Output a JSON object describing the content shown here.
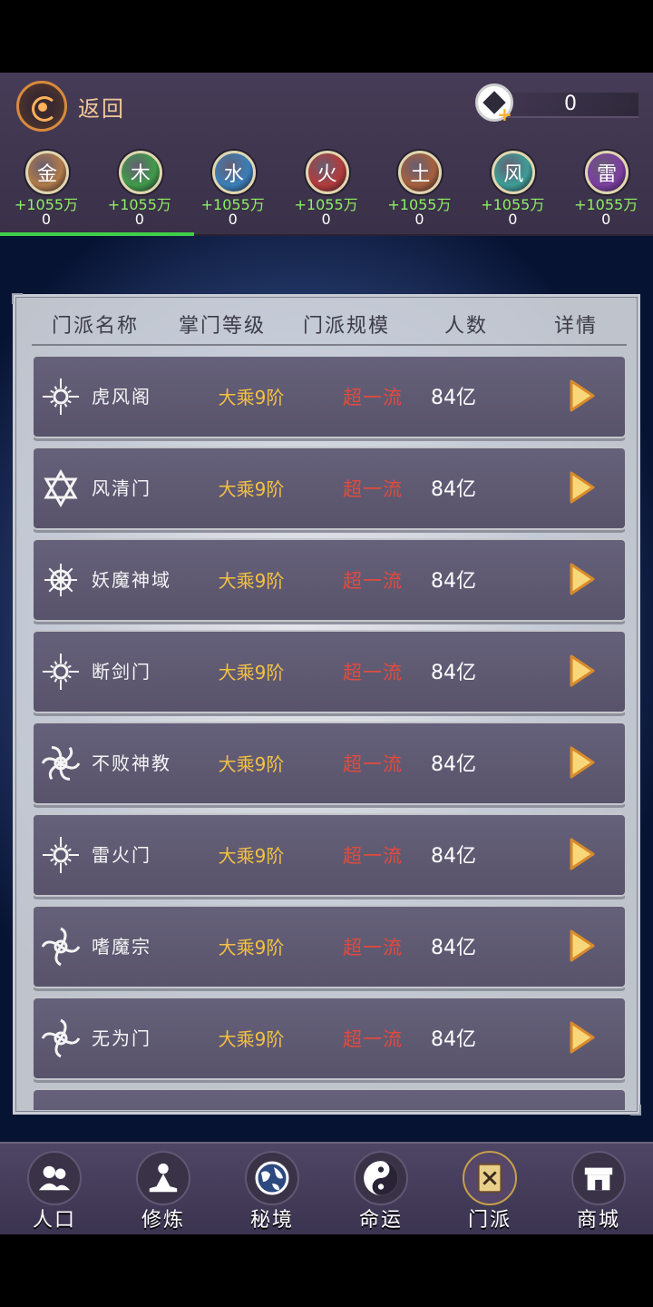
{
  "header": {
    "back_label": "返回",
    "currency_value": "0"
  },
  "elements": [
    {
      "char": "金",
      "gain": "+1055万",
      "count": "0",
      "color": "#b07a4a"
    },
    {
      "char": "木",
      "gain": "+1055万",
      "count": "0",
      "color": "#3f9a4a"
    },
    {
      "char": "水",
      "gain": "+1055万",
      "count": "0",
      "color": "#3a7fb8"
    },
    {
      "char": "火",
      "gain": "+1055万",
      "count": "0",
      "color": "#b23b3b"
    },
    {
      "char": "土",
      "gain": "+1055万",
      "count": "0",
      "color": "#a5603e"
    },
    {
      "char": "风",
      "gain": "+1055万",
      "count": "0",
      "color": "#3e9d96"
    },
    {
      "char": "雷",
      "gain": "+1055万",
      "count": "0",
      "color": "#7c3ea0"
    }
  ],
  "table": {
    "headers": {
      "name": "门派名称",
      "leader_level": "掌门等级",
      "scale": "门派规模",
      "population": "人数",
      "details": "详情"
    },
    "rows": [
      {
        "name": "虎风阁",
        "rank": "大乘9阶",
        "scale": "超一流",
        "population": "84亿",
        "emblem": "sun-emblem-icon"
      },
      {
        "name": "风清门",
        "rank": "大乘9阶",
        "scale": "超一流",
        "population": "84亿",
        "emblem": "hexagram-emblem-icon"
      },
      {
        "name": "妖魔神域",
        "rank": "大乘9阶",
        "scale": "超一流",
        "population": "84亿",
        "emblem": "triskele-emblem-icon"
      },
      {
        "name": "断剑门",
        "rank": "大乘9阶",
        "scale": "超一流",
        "population": "84亿",
        "emblem": "star-emblem-icon"
      },
      {
        "name": "不败神教",
        "rank": "大乘9阶",
        "scale": "超一流",
        "population": "84亿",
        "emblem": "spiral-emblem-icon"
      },
      {
        "name": "雷火门",
        "rank": "大乘9阶",
        "scale": "超一流",
        "population": "84亿",
        "emblem": "sun-emblem-icon"
      },
      {
        "name": "嗜魔宗",
        "rank": "大乘9阶",
        "scale": "超一流",
        "population": "84亿",
        "emblem": "shuriken-emblem-icon"
      },
      {
        "name": "无为门",
        "rank": "大乘9阶",
        "scale": "超一流",
        "population": "84亿",
        "emblem": "vortex-emblem-icon"
      }
    ]
  },
  "nav": [
    {
      "label": "人口",
      "icon": "people-icon"
    },
    {
      "label": "修炼",
      "icon": "meditation-icon"
    },
    {
      "label": "秘境",
      "icon": "globe-icon"
    },
    {
      "label": "命运",
      "icon": "yin-yang-icon"
    },
    {
      "label": "门派",
      "icon": "sect-book-icon",
      "active": true
    },
    {
      "label": "商城",
      "icon": "shop-icon"
    }
  ],
  "colors": {
    "gain": "#8ef064",
    "rank": "#f3c142",
    "scale": "#e34a3c",
    "tab_active": "#3fcf48"
  }
}
